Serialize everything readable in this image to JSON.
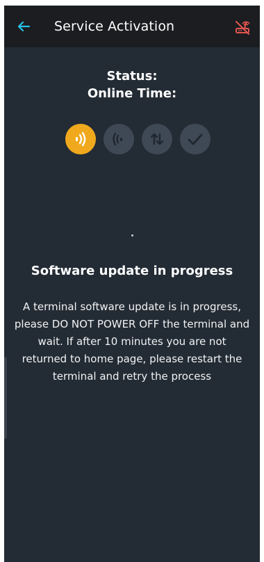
{
  "header": {
    "title": "Service Activation",
    "back_icon": "arrow-left-icon",
    "status_icon": "router-offline-icon",
    "accent_color": "#27c2e8",
    "alert_color": "#e2554f"
  },
  "status": {
    "status_label": "Status:",
    "online_time_label": "Online Time:"
  },
  "steps": [
    {
      "icon": "signal-waves-icon",
      "state": "active"
    },
    {
      "icon": "receiving-waves-icon",
      "state": "inactive"
    },
    {
      "icon": "data-transfer-icon",
      "state": "inactive"
    },
    {
      "icon": "checkmark-icon",
      "state": "inactive"
    }
  ],
  "update": {
    "heading": "Software update in progress",
    "message": "A terminal software update is in progress, please DO NOT POWER OFF the terminal and wait. If after 10 minutes you are not returned to home page, please restart the terminal and retry the process"
  },
  "colors": {
    "background": "#232b34",
    "active_step": "#f0a91d",
    "inactive_step": "#3e4955"
  }
}
